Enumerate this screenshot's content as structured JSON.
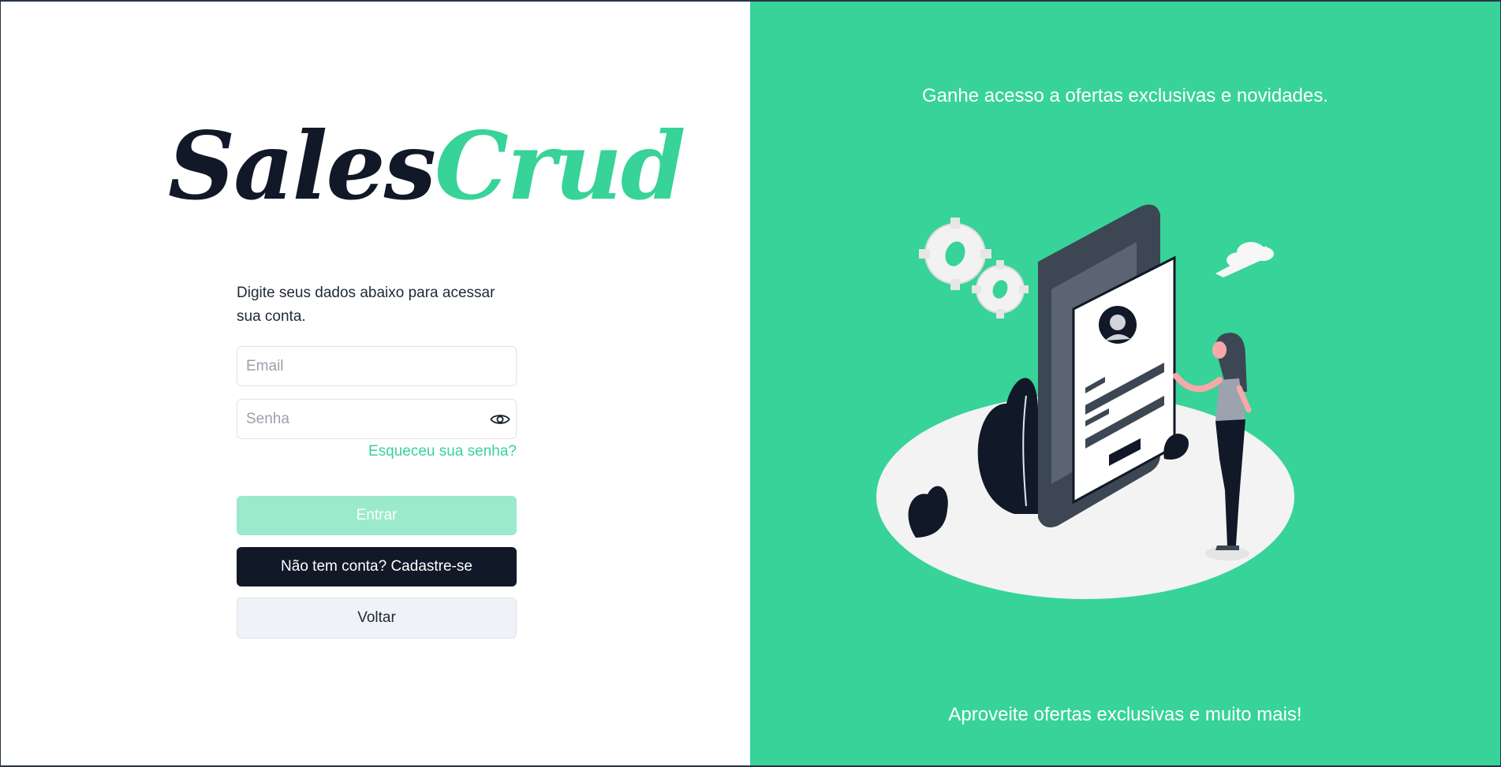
{
  "brand": {
    "part1": "Sales",
    "part2": "Crud",
    "color_dark": "#111827",
    "color_accent": "#37d399"
  },
  "login": {
    "intro": "Digite seus dados abaixo para acessar sua conta.",
    "email_placeholder": "Email",
    "email_value": "",
    "password_placeholder": "Senha",
    "password_value": "",
    "password_toggle_icon": "eye-icon",
    "forgot_label": "Esqueceu sua senha?",
    "submit_label": "Entrar",
    "signup_label": "Não tem conta? Cadastre-se",
    "back_label": "Voltar"
  },
  "promo": {
    "headline": "Ganhe acesso a ofertas exclusivas e novidades.",
    "footer": "Aproveite ofertas exclusivas e muito mais!",
    "background": "#37d399",
    "illustration": "woman-with-phone-illustration"
  }
}
